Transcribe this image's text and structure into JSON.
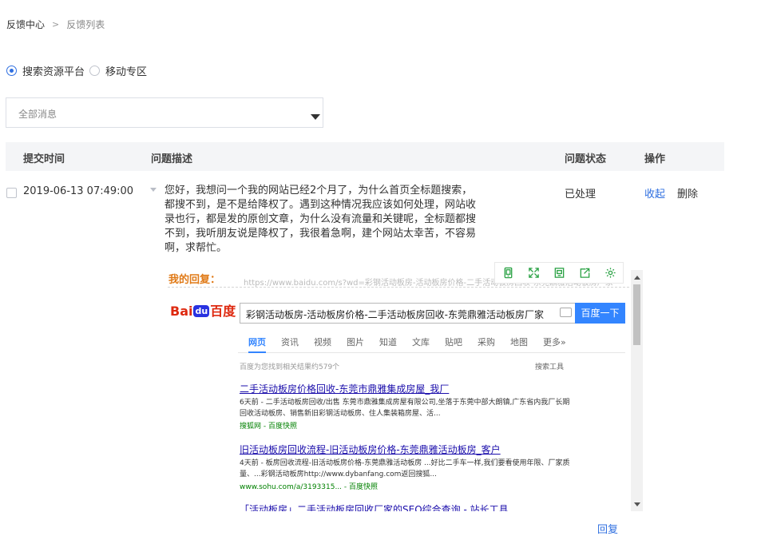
{
  "breadcrumb": {
    "root": "反馈中心",
    "separator": ">",
    "current": "反馈列表"
  },
  "filter": {
    "options": [
      {
        "label": "搜索资源平台",
        "checked": true
      },
      {
        "label": "移动专区",
        "checked": false
      }
    ],
    "select_value": "全部消息"
  },
  "table": {
    "headers": {
      "time": "提交时间",
      "description": "问题描述",
      "status": "问题状态",
      "action": "操作"
    },
    "rows": [
      {
        "time": "2019-06-13 07:49:00",
        "description": "您好，我想问一个我的网站已经2个月了，为什么首页全标题搜索，都搜不到，是不是给降权了。遇到这种情况我应该如何处理，网站收录也行，都是发的原创文章，为什么没有流量和关键呢，全标题都搜不到，我听朋友说是降权了，我很着急啊，建个网站太幸苦，不容易啊，求帮忙。",
        "status": "已处理",
        "collapse_label": "收起",
        "delete_label": "删除"
      }
    ]
  },
  "reply": {
    "label": "我的回复：",
    "link_label": "回复"
  },
  "toolbar_icons": [
    "phone-icon",
    "fullscreen-icon",
    "save-icon",
    "export-icon",
    "settings-icon"
  ],
  "colors": {
    "accent": "#2f6fe0",
    "reply_label": "#e07a17",
    "header_bg": "#f4f5f7"
  },
  "screenshot": {
    "url_text": "https://www.baidu.com/s?wd=彩钢活动板房-活动板房价格-二手活动板房回收-东莞鼎雅活动板房厂家",
    "logo": {
      "left": "Bai",
      "paw": "du",
      "right": "百度"
    },
    "query": "彩钢活动板房-活动板房价格-二手活动板房回收-东莞鼎雅活动板房厂家",
    "search_button": "百度一下",
    "tabs": [
      "网页",
      "资讯",
      "视频",
      "图片",
      "知道",
      "文库",
      "贴吧",
      "采购",
      "地图",
      "更多»"
    ],
    "result_count": "百度为您找到相关结果约579个",
    "search_tools": "搜索工具",
    "results": [
      {
        "title": "二手活动板房价格回收-东莞市鼎雅集成房屋_我厂",
        "snippet": "6天前 - 二手活动板房回收/出售 东莞市鼎雅集成房屋有限公司,坐落于东莞中部大朗镇,广东省内我厂长期回收活动板房、销售新旧彩钢活动板房、住人集装箱房屋、活...",
        "url": "搜狐网 - 百度快照"
      },
      {
        "title": "旧活动板房回收流程-旧活动板房价格-东莞鼎雅活动板房_客户",
        "snippet": "4天前 - 板房回收流程-旧活动板房价格-东莞鼎雅活动板房 ...好比二手车一样,我们要看使用年限、厂家质量、...彩钢活动板房http://www.dybanfang.com返回搜狐...",
        "url": "www.sohu.com/a/3193315... - 百度快照"
      },
      {
        "title": "「活动板房」二手活动板房回收厂家的SEO综合查询 - 站长工具",
        "snippet": "",
        "url": ""
      }
    ]
  }
}
